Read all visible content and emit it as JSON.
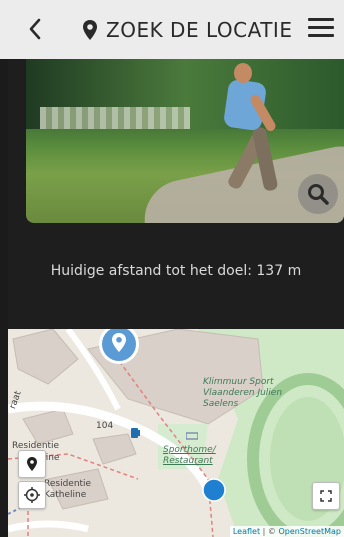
{
  "header": {
    "back_icon": "chevron-left-icon",
    "location_icon": "location-pin-icon",
    "title": "ZOEK DE LOCATIE",
    "menu_icon": "hamburger-menu-icon"
  },
  "clue": {
    "search_icon": "magnifier-icon",
    "distance_text": "Huidige afstand tot het doel: 137 m"
  },
  "map": {
    "labels": {
      "poi_name": "Klimmuur Sport Vlaanderen Julien Saelens",
      "restaurant": "Sporthome/ Restaurant",
      "residentie_1": "Residentie",
      "residentie_1b": "dine",
      "residentie_2": "Residentie",
      "residentie_2b": "Katheline",
      "house_number": "104",
      "street_fragment": "raat"
    },
    "buttons": {
      "marker_button_icon": "map-marker-icon",
      "locate_button_icon": "crosshair-locate-icon",
      "fullscreen_button_icon": "fullscreen-icon"
    },
    "attribution": {
      "leaflet": "Leaflet",
      "separator": " | © ",
      "osm": "OpenStreetMap"
    },
    "colors": {
      "target_pin": "#5b9bd5",
      "user_dot": "#1f7fd1",
      "park": "#cfe8c6",
      "track": "#aad5a0"
    }
  }
}
